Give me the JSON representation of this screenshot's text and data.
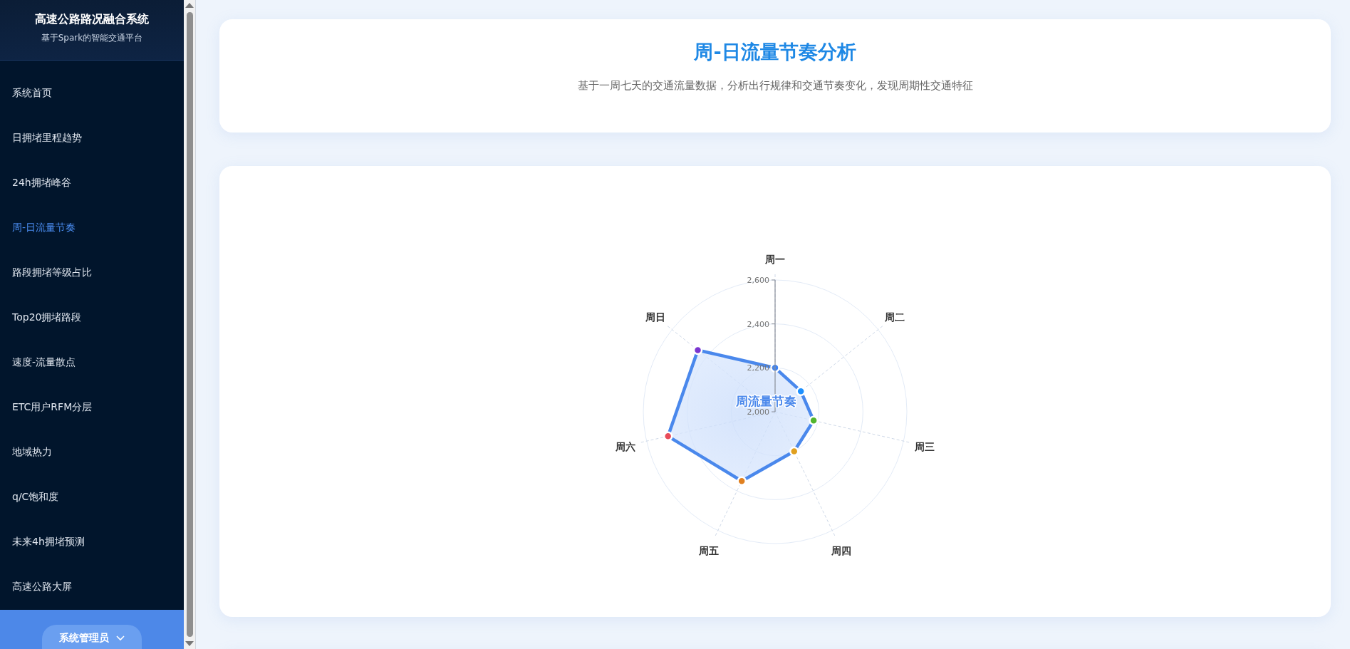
{
  "sidebar": {
    "title": "高速公路路况融合系统",
    "subtitle": "基于Spark的智能交通平台",
    "items": [
      {
        "label": "系统首页",
        "selected": false
      },
      {
        "label": "日拥堵里程趋势",
        "selected": false
      },
      {
        "label": "24h拥堵峰谷",
        "selected": false
      },
      {
        "label": "周-日流量节奏",
        "selected": true
      },
      {
        "label": "路段拥堵等级占比",
        "selected": false
      },
      {
        "label": "Top20拥堵路段",
        "selected": false
      },
      {
        "label": "速度-流量散点",
        "selected": false
      },
      {
        "label": "ETC用户RFM分层",
        "selected": false
      },
      {
        "label": "地域热力",
        "selected": false
      },
      {
        "label": "q/C饱和度",
        "selected": false
      },
      {
        "label": "未来4h拥堵预测",
        "selected": false
      },
      {
        "label": "高速公路大屏",
        "selected": false
      }
    ],
    "user_menu": {
      "label": "系统管理员"
    }
  },
  "header": {
    "title": "周-日流量节奏分析",
    "description": "基于一周七天的交通流量数据，分析出行规律和交通节奏变化，发现周期性交通特征"
  },
  "chart_card": {
    "chart_data": {
      "type": "radar",
      "title": "周流量节奏",
      "categories": [
        "周一",
        "周二",
        "周三",
        "周四",
        "周五",
        "周六",
        "周日"
      ],
      "series": [
        {
          "color": "#4a88ec",
          "values": [
            2200,
            2150,
            2180,
            2200,
            2350,
            2500,
            2450
          ]
        }
      ],
      "ylim": [
        2000,
        2600
      ],
      "yticks": [
        {
          "value": 2000,
          "label": "2,000"
        },
        {
          "value": 2200,
          "label": "2,200"
        },
        {
          "value": 2400,
          "label": "2,400"
        },
        {
          "value": 2600,
          "label": "2,600"
        }
      ]
    }
  }
}
